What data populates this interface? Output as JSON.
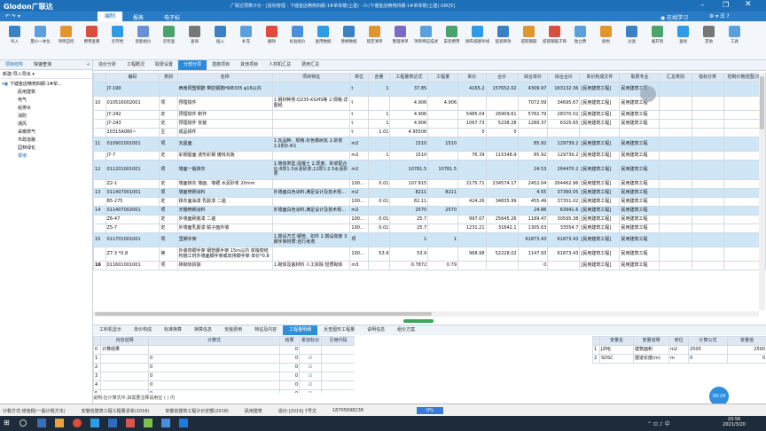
{
  "app": {
    "logo": "Glodon广联达",
    "title": "广联达预算计价 - [投标管理 - 下塘金店精苑四期-1#单体楼(土建) - D:/下塘金店精苑四期-1#单体楼(土建).GBQ5]",
    "online_learn": "在线学习"
  },
  "menu": [
    "编制",
    "报表",
    "电子标"
  ],
  "ribbon": {
    "buttons": [
      "导入",
      "量价一体化",
      "项目自检",
      "费用查看",
      "云存档",
      "智能组价",
      "云检查",
      "查询",
      "插入",
      "补充",
      "删除",
      "标准组价",
      "复用数据",
      "替换数据",
      "锁定清单",
      "整理清单",
      "项目特征描述",
      "安装费用",
      "颁布纸图导线",
      "超高降效",
      "提取钢筋",
      "提取钢筋子目",
      "独立费",
      "颜色",
      "过滤",
      "展开到",
      "查找",
      "其他",
      "工具"
    ]
  },
  "left": {
    "tabs": [
      "项目结构",
      "快速查询"
    ],
    "new_label": "新建-导入导出",
    "root": "下塘金店精苑四期-1#单...",
    "items": [
      "民用建筑",
      "电气",
      "给排水",
      "消防",
      "通风",
      "采暖燃气",
      "市政道路",
      "园林绿化",
      "报墙"
    ]
  },
  "topTabs": [
    "造价分析",
    "工程概况",
    "取费设置",
    "分部分项",
    "措施项目",
    "其他项目",
    "人材机汇总",
    "费用汇总"
  ],
  "activeTopTab": "分部分项",
  "grid": {
    "headers": [
      "编码",
      "类别",
      "名称",
      "项目特征",
      "单位",
      "含量",
      "工程量表达式",
      "工程量",
      "单价",
      "合价",
      "综合单价",
      "综合合价",
      "单价构成文件",
      "取费专业",
      "汇总类别",
      "指标分类",
      "控制价格范围(元)"
    ],
    "rows": [
      {
        "no": "",
        "code": "J7-190",
        "cat": "",
        "name": "西南阳塑钢筋 带肋钢筋HRB335 φ16以内",
        "feat": "",
        "unit": "t",
        "qty": "1",
        "expr": "37.85",
        "amt": "",
        "price": "4165.2",
        "sum": "157652.02",
        "uprice": "4309.97",
        "usum": "163132.36",
        "file": "[民用建筑工程]",
        "prof": "民用建筑工程",
        "cls": "blue"
      },
      {
        "no": "10",
        "code": "010516002001",
        "cat": "项",
        "name": "预埋铁件",
        "feat": "1.钢材种类:Q235-KGHS等 2.规格:详图纸",
        "unit": "t",
        "qty": "",
        "expr": "4.906",
        "amt": "4.906",
        "price": "",
        "sum": "",
        "uprice": "7072.09",
        "usum": "34695.67",
        "file": "[民用建筑工程]",
        "prof": "民用建筑工程",
        "cls": ""
      },
      {
        "no": "",
        "code": "J7-242",
        "cat": "定",
        "name": "预埋铁件 制作",
        "feat": "",
        "unit": "t",
        "qty": "1",
        "expr": "4.906",
        "amt": "",
        "price": "5485.04",
        "sum": "26909.61",
        "uprice": "5782.79",
        "usum": "28370.02",
        "file": "[民用建筑工程]",
        "prof": "民用建筑工程",
        "cls": ""
      },
      {
        "no": "",
        "code": "J7-243",
        "cat": "定",
        "name": "预埋铁件 安装",
        "feat": "",
        "unit": "t",
        "qty": "1",
        "expr": "4.906",
        "amt": "",
        "price": "1067.73",
        "sum": "5238.28",
        "uprice": "1289.37",
        "usum": "6325.65",
        "file": "[民用建筑工程]",
        "prof": "民用建筑工程",
        "cls": ""
      },
      {
        "no": "",
        "code": "20315A080~",
        "cat": "主",
        "name": "成品铁件",
        "feat": "",
        "unit": "t",
        "qty": "1.01",
        "expr": "4.95506",
        "amt": "",
        "price": "0",
        "sum": "0",
        "uprice": "",
        "usum": "",
        "file": "",
        "prof": "",
        "cls": ""
      },
      {
        "no": "11",
        "code": "010901001001",
        "cat": "项",
        "name": "瓦屋面",
        "feat": "1.瓦品种、规格:灰色橡树瓦 2.砂浆1:2的0.4/1",
        "unit": "m2",
        "qty": "",
        "expr": "1510",
        "amt": "1510",
        "price": "",
        "sum": "",
        "uprice": "85.92",
        "usum": "129739.2",
        "file": "[民用建筑工程]",
        "prof": "民用建筑工程",
        "cls": "blue"
      },
      {
        "no": "",
        "code": "J7-7",
        "cat": "定",
        "name": "彩钢屋面 波形彩钢 镀锌瓦板",
        "feat": "",
        "unit": "m2",
        "qty": "1",
        "expr": "1510",
        "amt": "",
        "price": "76.39",
        "sum": "115348.9",
        "uprice": "85.92",
        "usum": "129739.2",
        "file": "[民用建筑工程]",
        "prof": "民用建筑工程",
        "cls": ""
      },
      {
        "no": "12",
        "code": "011201001001",
        "cat": "项",
        "name": "墙面一般抹灰",
        "feat": "1.墙体类型:混凝土 2.厚度、砂浆配合比:8厚1:3水泥砂浆,12厚1:2.5水泥砂浆",
        "unit": "m2",
        "qty": "",
        "expr": "10781.5",
        "amt": "10781.5",
        "price": "",
        "sum": "",
        "uprice": "24.53",
        "usum": "264470.2",
        "file": "[民用建筑工程]",
        "prof": "民用建筑工程",
        "cls": "blue"
      },
      {
        "no": "",
        "code": "Z2-1",
        "cat": "定",
        "name": "墙面抹灰 墙面、墙裙 水泥砂浆 20mm",
        "feat": "",
        "unit": "100m2",
        "qty": "0.01",
        "expr": "107.815",
        "amt": "",
        "price": "2175.71",
        "sum": "234574.17",
        "uprice": "2452.04",
        "usum": "264462.96",
        "file": "[民用建筑工程]",
        "prof": "民用建筑工程",
        "cls": ""
      },
      {
        "no": "13",
        "code": "011407001001",
        "cat": "项",
        "name": "墙面喷刷涂料",
        "feat": "外墙面白色涂料,满足设计及技术规范要求",
        "unit": "m2",
        "qty": "",
        "expr": "8211",
        "amt": "8211",
        "price": "",
        "sum": "",
        "uprice": "4.55",
        "usum": "37360.05",
        "file": "[民用建筑工程]",
        "prof": "民用建筑工程",
        "cls": "blue"
      },
      {
        "no": "",
        "code": "B5-275",
        "cat": "定",
        "name": "抹灰面油漆 乳胶漆 二遍",
        "feat": "",
        "unit": "100m2",
        "qty": "0.01",
        "expr": "82.11",
        "amt": "",
        "price": "424.26",
        "sum": "34835.99",
        "uprice": "455.49",
        "usum": "37351.02",
        "file": "[民用建筑工程]",
        "prof": "民用建筑工程",
        "cls": ""
      },
      {
        "no": "14",
        "code": "011407002001",
        "cat": "项",
        "name": "天棚喷刷涂料",
        "feat": "外墙面白色涂料,满足设计及技术规范要求",
        "unit": "m2",
        "qty": "",
        "expr": "2570",
        "amt": "2570",
        "price": "",
        "sum": "",
        "uprice": "24.88",
        "usum": "63941.6",
        "file": "[民用建筑工程]",
        "prof": "民用建筑工程",
        "cls": "blue"
      },
      {
        "no": "",
        "code": "Z6-47",
        "cat": "定",
        "name": "外墙面刷底漆 二遍",
        "feat": "",
        "unit": "100m2",
        "qty": "0.01",
        "expr": "25.7",
        "amt": "",
        "price": "997.07",
        "sum": "25645.26",
        "uprice": "1189.47",
        "usum": "30595.38",
        "file": "[民用建筑工程]",
        "prof": "民用建筑工程",
        "cls": ""
      },
      {
        "no": "",
        "code": "Z5-7",
        "cat": "定",
        "name": "外墙面乳胶漆 腻子面外墙",
        "feat": "",
        "unit": "100m2",
        "qty": "0.01",
        "expr": "25.7",
        "amt": "",
        "price": "1231.21",
        "sum": "31642.1",
        "uprice": "1305.63",
        "usum": "33554.7",
        "file": "[民用建筑工程]",
        "prof": "民用建筑工程",
        "cls": ""
      },
      {
        "no": "15",
        "code": "011701001001",
        "cat": "项",
        "name": "里脚手架",
        "feat": "1.搭设方式:钢管、扣件 2.搭设高度 3.脚手架材质:自行考虑",
        "unit": "项",
        "qty": "",
        "expr": "1",
        "amt": "1",
        "price": "",
        "sum": "",
        "uprice": "61873.43",
        "usum": "61873.43",
        "file": "[民用建筑工程]",
        "prof": "民用建筑工程",
        "cls": "blue"
      },
      {
        "no": "",
        "code": "Z7-3 *0.8",
        "cat": "换",
        "name": "外装饰脚手架 钢管脚手架 15m以内 单独按结构施工时外墙面脚手架或双排脚手架 单价*0.8",
        "feat": "",
        "unit": "100m2",
        "qty": "53.9",
        "expr": "53.9",
        "amt": "",
        "price": "968.98",
        "sum": "52228.02",
        "uprice": "1147.93",
        "usum": "61873.43",
        "file": "[民用建筑工程]",
        "prof": "民用建筑工程",
        "cls": ""
      },
      {
        "no": "16",
        "code": "011601001001",
        "cat": "项",
        "name": "砖砌体拆除",
        "feat": "1.砌体及装材料 人工拆除 轻质砌体",
        "unit": "m3",
        "qty": "",
        "expr": "0.7872",
        "amt": "0.79",
        "price": "",
        "sum": "",
        "uprice": "0",
        "usum": "",
        "file": "[民用建筑工程]",
        "prof": "民用建筑工程",
        "cls": "sel"
      }
    ]
  },
  "bottomTabs": [
    "工料机显示",
    "单价构成",
    "标准换算",
    "换算信息",
    "安装费用",
    "特征及内容",
    "工程量明细",
    "反查图形工程量",
    "说明信息",
    "组价方案"
  ],
  "activeBottomTab": "工程量明细",
  "detail": {
    "headers": [
      "内容说明",
      "计算式",
      "结果",
      "累加标识",
      "引用代码"
    ],
    "rows": [
      {
        "no": "0",
        "name": "计算结果",
        "formula": "",
        "result": "0"
      },
      {
        "no": "1",
        "name": "",
        "formula": "0",
        "result": "0"
      },
      {
        "no": "2",
        "name": "",
        "formula": "0",
        "result": "0"
      },
      {
        "no": "3",
        "name": "",
        "formula": "0",
        "result": "0"
      },
      {
        "no": "4",
        "name": "",
        "formula": "0",
        "result": "0"
      },
      {
        "no": "5",
        "name": "",
        "formula": "0",
        "result": "0"
      }
    ]
  },
  "vars": {
    "headers": [
      "变量名",
      "变量说明",
      "单位",
      "计算公式",
      "变量值"
    ],
    "rows": [
      {
        "no": "1",
        "name": "JZMJ",
        "desc": "建筑面积",
        "unit": "m2",
        "formula": "2500",
        "value": "2500"
      },
      {
        "no": "2",
        "name": "SDSC",
        "desc": "隧道长度(m)",
        "unit": "m",
        "formula": "0",
        "value": "0"
      }
    ]
  },
  "hint": "说明:在计算式中,如需要注释请用在 ( ) 内",
  "status": {
    "items": [
      "计税方式:增值税(一般计税方法)",
      "安徽省建筑工程工程量清单(2018)",
      "安徽省建筑工程计价定额(2018)",
      "民用建筑",
      "造价:[2019] 7号文",
      "18705698238"
    ],
    "zoom": "0%"
  },
  "clock": {
    "time": "20:56",
    "date": "2021/3/20"
  },
  "timer": "00:24"
}
